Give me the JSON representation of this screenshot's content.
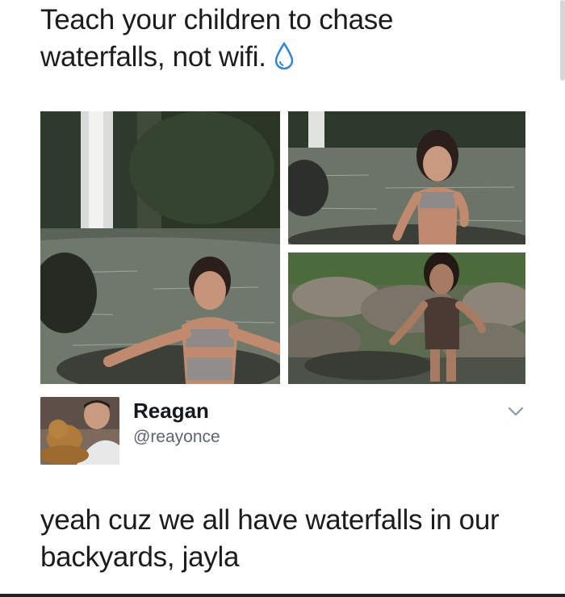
{
  "post": {
    "text": "Teach your children to chase waterfalls, not wifi.",
    "emoji_icon": "water-droplet-icon"
  },
  "photos": [
    {
      "subject": "waterfall-girl-wide"
    },
    {
      "subject": "girl-in-stream"
    },
    {
      "subject": "girl-on-rocks"
    }
  ],
  "reply_user": {
    "display_name": "Reagan",
    "handle": "@reayonce"
  },
  "reply": {
    "text": "yeah cuz we all have waterfalls in our backyards, jayla"
  },
  "colors": {
    "droplet": "#2f86d6",
    "handle": "#5b6670"
  }
}
